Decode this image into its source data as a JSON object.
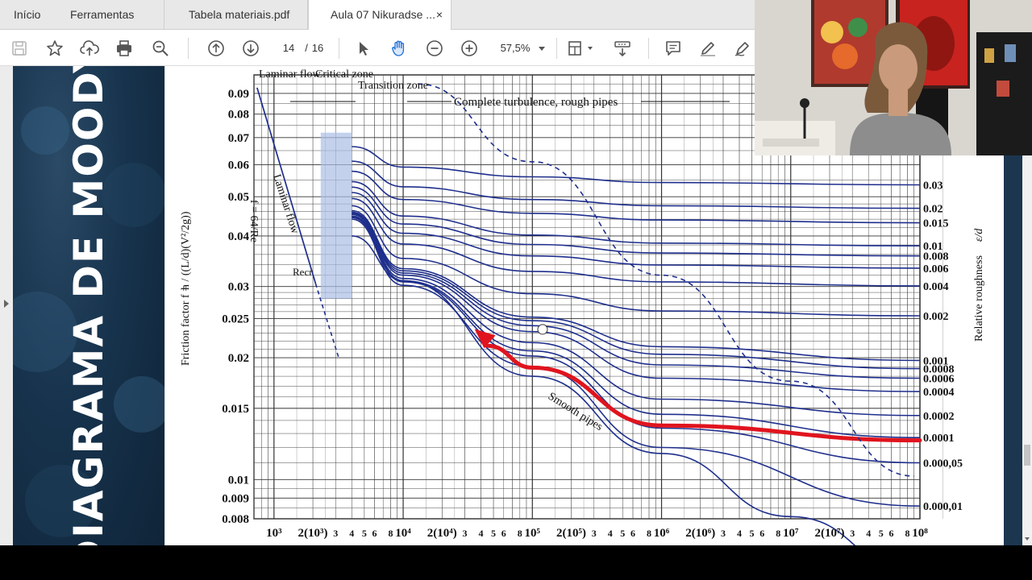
{
  "tabs": {
    "home": "Início",
    "tools": "Ferramentas",
    "file1": "Tabela materiais.pdf",
    "file2": "Aula 07 Nikuradse ...",
    "close": "×"
  },
  "toolbar": {
    "page_current": "14",
    "page_separator": "/",
    "page_total": "16",
    "zoom": "57,5%"
  },
  "banner": {
    "title": "DIAGRAMA DE MOODY"
  },
  "chart_data": {
    "type": "line",
    "title": "",
    "xlabel": "",
    "ylabel": "Friction factor f =",
    "ylabel_formula": "h / ((L/d)(V²/2g))",
    "y2label": "Relative roughness",
    "y2label_symbol": "ε/d",
    "xscale": "log",
    "yscale": "log",
    "xlim": [
      700,
      100000000
    ],
    "ylim": [
      0.008,
      0.1
    ],
    "grid": true,
    "zones": {
      "laminar": "Laminar flow",
      "laminar_line": "Laminar",
      "critical": "Critical zone",
      "transition": "Transition zone",
      "complete": "Complete turbulence, rough pipes",
      "laminar_flow_label": "Laminar flow",
      "laminar_eq": "f = 64/Re",
      "re_cr": "Recr",
      "smooth": "Smooth pipes"
    },
    "y_ticks": [
      "0.09",
      "0.08",
      "0.07",
      "0.06",
      "0.05",
      "0.04",
      "0.03",
      "0.025",
      "0.02",
      "0.015",
      "0.01",
      "0.009",
      "0.008"
    ],
    "x_ticks": [
      "10³",
      "2(10³)",
      "3",
      "4",
      "5",
      "6",
      "8",
      "10⁴",
      "2(10⁴)",
      "3",
      "4",
      "5",
      "6",
      "8",
      "10⁵",
      "2(10⁵)",
      "3",
      "4",
      "5",
      "6",
      "8",
      "10⁶",
      "2(10⁶)",
      "3",
      "4",
      "5",
      "6",
      "8",
      "10⁷",
      "2(10⁷)",
      "3",
      "4",
      "5",
      "6",
      "8",
      "10⁸"
    ],
    "roughness_labels": [
      "0.03",
      "0.02",
      "0.015",
      "0.01",
      "0.008",
      "0.006",
      "0.004",
      "0.002",
      "0.001",
      "0.0008",
      "0.0006",
      "0.0004",
      "0.0002",
      "0.0001",
      "0.000,05",
      "0.000,01"
    ],
    "roughness_values": [
      0.03,
      0.02,
      0.015,
      0.01,
      0.008,
      0.006,
      0.004,
      0.002,
      0.001,
      0.0008,
      0.0006,
      0.0004,
      0.0002,
      0.0001,
      5e-05,
      1e-05
    ],
    "series": [
      {
        "values": [
          0.0665,
          0.0592,
          0.056,
          0.0542,
          0.0535
        ]
      },
      {
        "values": [
          0.0612,
          0.0529,
          0.0492,
          0.0475,
          0.0468
        ]
      },
      {
        "values": [
          0.0578,
          0.0492,
          0.0455,
          0.0438,
          0.0431
        ]
      },
      {
        "values": [
          0.0545,
          0.0448,
          0.0402,
          0.0384,
          0.0378
        ]
      },
      {
        "values": [
          0.0528,
          0.0428,
          0.0381,
          0.0363,
          0.0357
        ]
      },
      {
        "values": [
          0.0512,
          0.0406,
          0.0357,
          0.0339,
          0.0333
        ]
      },
      {
        "values": [
          0.0495,
          0.0382,
          0.0327,
          0.0308,
          0.0301
        ]
      },
      {
        "values": [
          0.0475,
          0.0352,
          0.0288,
          0.0261,
          0.0254
        ]
      },
      {
        "values": [
          0.0462,
          0.0332,
          0.0252,
          0.0213,
          0.0197
        ]
      },
      {
        "values": [
          0.0458,
          0.0328,
          0.0247,
          0.0204,
          0.0188
        ]
      },
      {
        "values": [
          0.0455,
          0.0324,
          0.024,
          0.0192,
          0.0178
        ]
      },
      {
        "values": [
          0.0452,
          0.032,
          0.0232,
          0.0178,
          0.0165
        ]
      },
      {
        "values": [
          0.0448,
          0.0314,
          0.0218,
          0.0158,
          0.0144
        ]
      },
      {
        "values": [
          0.0446,
          0.031,
          0.0208,
          0.0145,
          0.0127
        ]
      },
      {
        "values": [
          0.0444,
          0.0308,
          0.0202,
          0.0134,
          0.011
        ]
      },
      {
        "values": [
          0.044,
          0.0302,
          0.019,
          0.012,
          0.0086
        ]
      }
    ],
    "series_x": [
      4000,
      10000,
      100000,
      1000000,
      100000000
    ],
    "smooth_pipes": {
      "x": [
        4000,
        10000,
        100000,
        1000000,
        10000000,
        100000000
      ],
      "y": [
        0.04,
        0.031,
        0.018,
        0.0116,
        0.0081,
        0.0058
      ]
    },
    "highlight_curve_relative_roughness": 0.0001,
    "highlight_color": "#e0141e",
    "curve_color": "#1f2f8c"
  },
  "webcam": {
    "description_icon": "presenter-video-icon"
  }
}
